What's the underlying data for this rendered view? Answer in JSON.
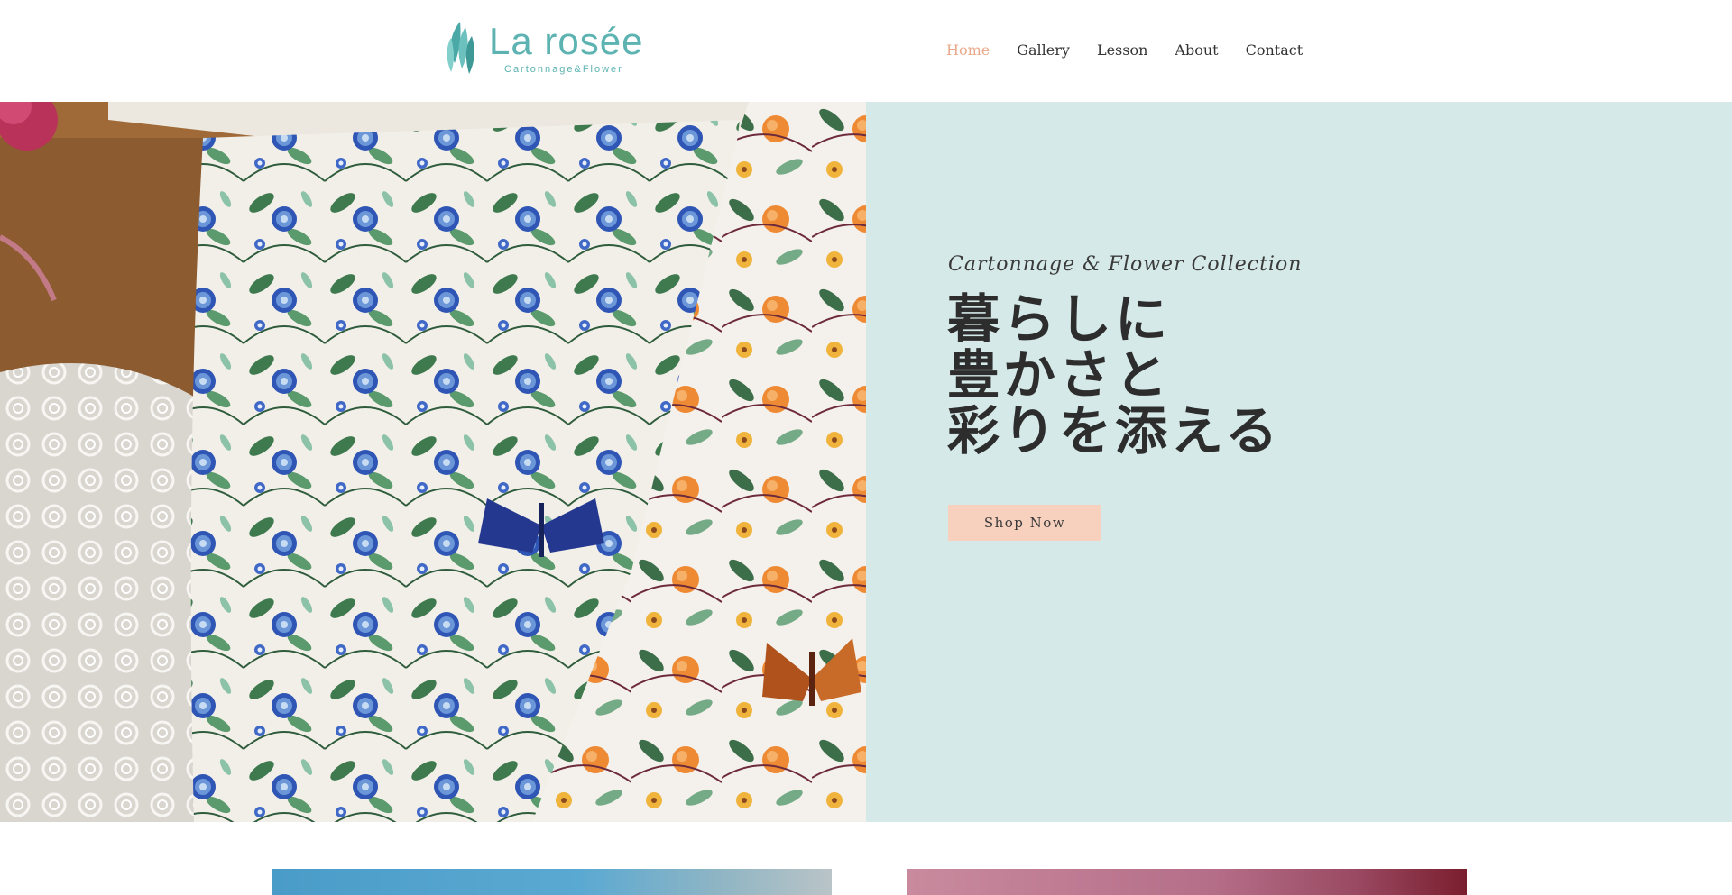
{
  "brand": {
    "name": "La rosée",
    "tagline": "Cartonnage&Flower"
  },
  "nav": {
    "items": [
      {
        "label": "Home",
        "active": true
      },
      {
        "label": "Gallery",
        "active": false
      },
      {
        "label": "Lesson",
        "active": false
      },
      {
        "label": "About",
        "active": false
      },
      {
        "label": "Contact",
        "active": false
      }
    ]
  },
  "hero": {
    "subtitle": "Cartonnage & Flower Collection",
    "headline_lines": [
      "暮らしに",
      "豊かさと",
      "彩りを添える"
    ],
    "cta_label": "Shop Now",
    "image_description": "floral-fabric-photo"
  },
  "colors": {
    "brand_teal": "#5cb3b1",
    "nav_active": "#e9a98a",
    "hero_panel_bg": "#d6e9e9",
    "cta_bg": "#f8d0be"
  }
}
